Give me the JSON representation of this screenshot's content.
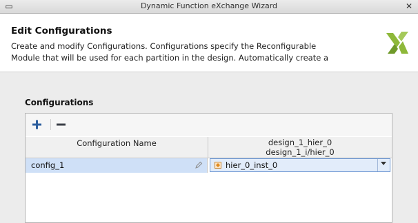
{
  "window": {
    "title": "Dynamic Function eXchange Wizard",
    "close_glyph": "✕",
    "min_glyph": "▭"
  },
  "header": {
    "title": "Edit Configurations",
    "description_line1": "Create and modify Configurations. Configurations specify the Reconfigurable",
    "description_line2": "Module that will be used for each partition in the design. Automatically create a",
    "logo": "xilinx-logo-icon"
  },
  "configurations": {
    "section_label": "Configurations",
    "toolbar": {
      "add_icon": "plus-icon",
      "remove_icon": "minus-icon"
    },
    "columns": {
      "name": "Configuration Name",
      "partition_line1": "design_1_hier_0",
      "partition_line2": "design_1_i/hier_0"
    },
    "rows": [
      {
        "name": "config_1",
        "edit_icon": "pencil-icon",
        "module": "hier_0_inst_0",
        "module_icon": "module-icon"
      }
    ]
  },
  "colors": {
    "selected_row": "#cfe0f7",
    "combo_border": "#6f98d3",
    "add_icon": "#2d5f9e",
    "logo_green": "#8eb83a"
  }
}
